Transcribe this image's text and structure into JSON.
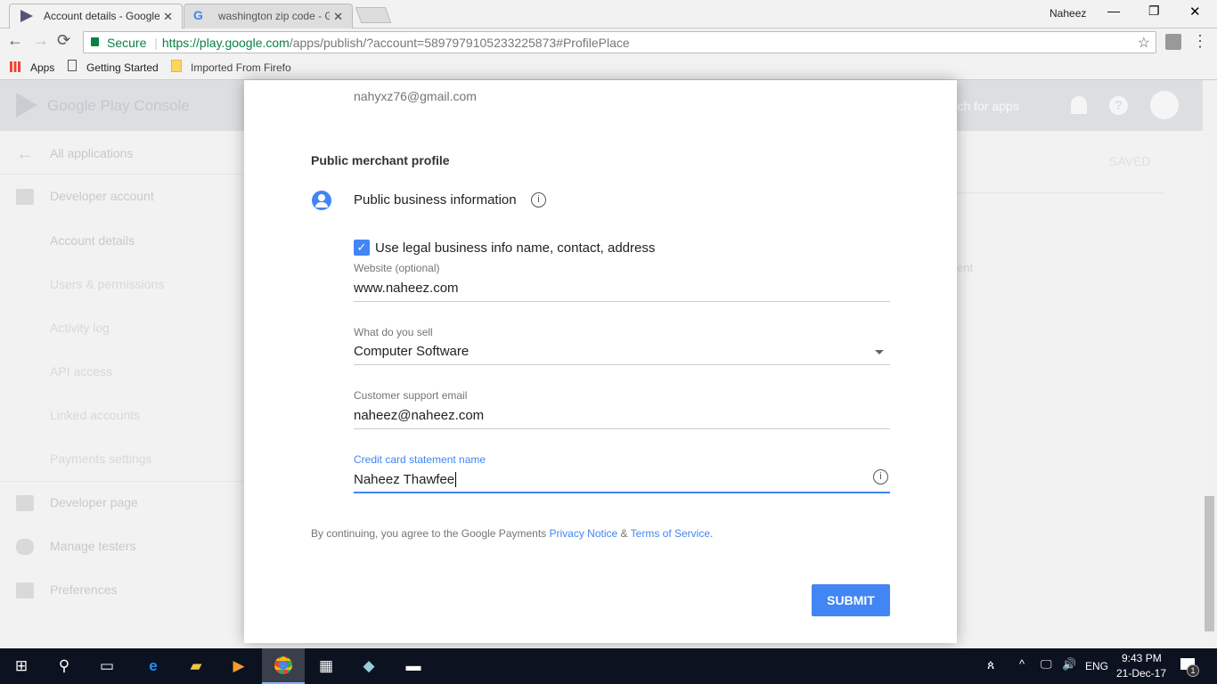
{
  "browser": {
    "tabs": [
      {
        "label": "Account details - Google",
        "close": "✕"
      },
      {
        "label": "washington zip code - Go",
        "close": "✕"
      }
    ],
    "user": "Naheez",
    "secure_label": "Secure",
    "url_host": "https://play.google.com",
    "url_path": "/apps/publish/?account=5897979105233225873#ProfilePlace",
    "bookmarks": [
      "Apps",
      "Getting Started",
      "Imported From Firefo"
    ]
  },
  "console": {
    "logo": "Google Play Console",
    "search_placeholder": "Search for apps",
    "saved": "SAVED",
    "partial_text": "ent",
    "sidebar": [
      "All applications",
      "Developer account",
      "Account details",
      "Users & permissions",
      "Activity log",
      "API access",
      "Linked accounts",
      "Payments settings",
      "Developer page",
      "Manage testers",
      "Preferences"
    ]
  },
  "modal": {
    "email": "nahyxz76@gmail.com",
    "section_title": "Public merchant profile",
    "pbi_label": "Public business information",
    "checkbox_label": "Use legal business info name, contact, address",
    "checkbox_checked": true,
    "website_label": "Website (optional)",
    "website_value": "www.naheez.com",
    "sell_label": "What do you sell",
    "sell_value": "Computer Software",
    "support_label": "Customer support email",
    "support_value": "naheez@naheez.com",
    "cc_label": "Credit card statement name",
    "cc_value": "Naheez Thawfee",
    "terms_prefix": "By continuing, you agree to the Google Payments ",
    "privacy": "Privacy Notice",
    "amp": " & ",
    "tos": "Terms of Service",
    "terms_suffix": ".",
    "submit": "SUBMIT",
    "accent": "#4285f4"
  },
  "taskbar": {
    "lang": "ENG",
    "time": "9:43 PM",
    "date": "21-Dec-17",
    "notifications": "1"
  }
}
